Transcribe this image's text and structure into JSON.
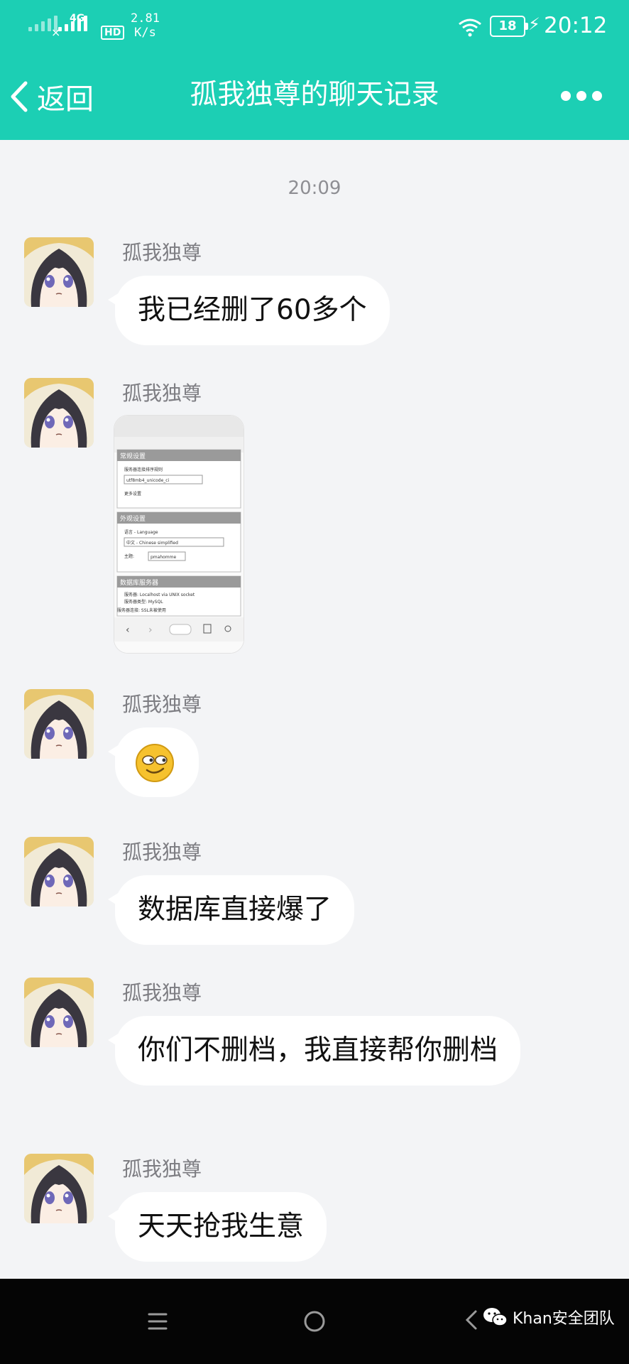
{
  "status_bar": {
    "network_type": "4G",
    "hd_label": "HD",
    "speed_value": "2.81",
    "speed_unit": "K/s",
    "battery": "18",
    "time": "20:12"
  },
  "header": {
    "back_label": "返回",
    "title": "孤我独尊的聊天记录",
    "accent_color": "#1ccfb4"
  },
  "chat": {
    "timestamp": "20:09",
    "messages": [
      {
        "sender": "孤我独尊",
        "type": "text",
        "text": "我已经删了60多个"
      },
      {
        "sender": "孤我独尊",
        "type": "image"
      },
      {
        "sender": "孤我独尊",
        "type": "emoji"
      },
      {
        "sender": "孤我独尊",
        "type": "text",
        "text": "数据库直接爆了"
      },
      {
        "sender": "孤我独尊",
        "type": "text",
        "text": "你们不删档，我直接帮你删档"
      },
      {
        "sender": "孤我独尊",
        "type": "text",
        "text": "天天抢我生意"
      }
    ]
  },
  "screenshot_image": {
    "header_text": "常规设置",
    "collation_label": "服务器连接排序规则",
    "collation_value": "utf8mb4_unicode_ci",
    "more_settings": "更多设置",
    "appearance_header": "外观设置",
    "language_label": "语言 - Language",
    "language_value": "中文 - Chinese simplified",
    "theme_label": "主题:",
    "theme_value": "pmahomme",
    "db_server_header": "数据库服务器",
    "server_line": "服务器: Localhost via UNIX socket",
    "server_type_line": "服务器类型: MySQL",
    "ssl_line": "服务器连接: SSL未被使用"
  },
  "bottom_nav": {
    "watermark": "Khan安全团队"
  }
}
